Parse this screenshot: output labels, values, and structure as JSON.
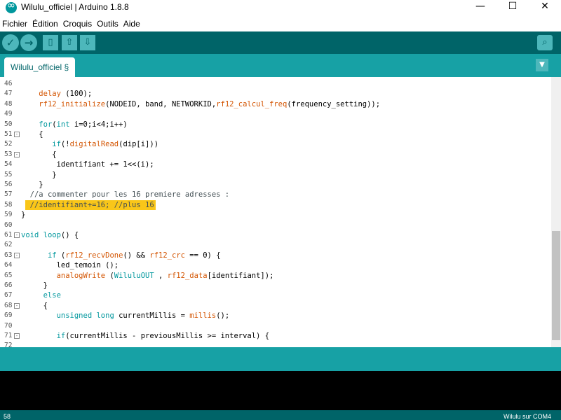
{
  "window": {
    "title": "Wilulu_officiel | Arduino 1.8.8",
    "controls": {
      "minimize": "—",
      "maximize": "☐",
      "close": "✕"
    }
  },
  "menu": [
    "Fichier",
    "Édition",
    "Croquis",
    "Outils",
    "Aide"
  ],
  "toolbar": {
    "buttons": [
      {
        "name": "verify",
        "icon": "check-icon",
        "glyph": "✓"
      },
      {
        "name": "upload",
        "icon": "arrow-right-icon",
        "glyph": "→"
      },
      {
        "name": "new",
        "icon": "new-file-icon",
        "glyph": "▯"
      },
      {
        "name": "open",
        "icon": "open-arrow-up-icon",
        "glyph": "⇧"
      },
      {
        "name": "save",
        "icon": "save-arrow-down-icon",
        "glyph": "⇩"
      }
    ],
    "serial_monitor": {
      "icon": "magnifier-icon",
      "glyph": "⌕"
    }
  },
  "tabs": [
    {
      "label": "Wilulu_officiel §"
    }
  ],
  "tab_menu_glyph": "▼",
  "editor": {
    "lines": [
      {
        "n": "46",
        "fold": "",
        "html": ""
      },
      {
        "n": "47",
        "fold": "",
        "html": "    <span class=\"f\">delay</span> (100);"
      },
      {
        "n": "48",
        "fold": "",
        "html": "    <span class=\"f\">rf12_initialize</span>(NODEID, band, NETWORKID,<span class=\"f\">rf12_calcul_freq</span>(frequency_setting));"
      },
      {
        "n": "49",
        "fold": "",
        "html": ""
      },
      {
        "n": "50",
        "fold": "",
        "html": "    <span class=\"k\">for</span>(<span class=\"k\">int</span> i=0;i&lt;4;i++)"
      },
      {
        "n": "51",
        "fold": "⊟",
        "html": "    {"
      },
      {
        "n": "52",
        "fold": "",
        "html": "       <span class=\"k\">if</span>(!<span class=\"f\">digitalRead</span>(dip[i]))"
      },
      {
        "n": "53",
        "fold": "⊟",
        "html": "       {"
      },
      {
        "n": "54",
        "fold": "",
        "html": "        identifiant += 1&lt;&lt;(i);"
      },
      {
        "n": "55",
        "fold": "",
        "html": "       }"
      },
      {
        "n": "56",
        "fold": "",
        "html": "    }"
      },
      {
        "n": "57",
        "fold": "",
        "html": "  <span class=\"c\">//a commenter pour les 16 premiere adresses :</span>"
      },
      {
        "n": "58",
        "fold": "",
        "html": "  <span class=\"c\">//identifiant+=16; //plus 16</span>",
        "highlight": true
      },
      {
        "n": "59",
        "fold": "",
        "html": "}"
      },
      {
        "n": "60",
        "fold": "",
        "html": ""
      },
      {
        "n": "61",
        "fold": "⊟",
        "html": "<span class=\"k\">void</span> <span class=\"k\">loop</span>() {"
      },
      {
        "n": "62",
        "fold": "",
        "html": ""
      },
      {
        "n": "63",
        "fold": "⊟",
        "html": "      <span class=\"k\">if</span> (<span class=\"f\">rf12_recvDone</span>() &amp;&amp; <span class=\"f\">rf12_crc</span> == 0) {"
      },
      {
        "n": "64",
        "fold": "",
        "html": "        led_temoin ();"
      },
      {
        "n": "65",
        "fold": "",
        "html": "        <span class=\"f\">analogWrite</span> (<span class=\"k\">WiluluOUT</span> , <span class=\"f\">rf12_data</span>[identifiant]);"
      },
      {
        "n": "66",
        "fold": "",
        "html": "     }"
      },
      {
        "n": "67",
        "fold": "",
        "html": "     <span class=\"k\">else</span>"
      },
      {
        "n": "68",
        "fold": "⊟",
        "html": "     {"
      },
      {
        "n": "69",
        "fold": "",
        "html": "        <span class=\"k\">unsigned</span> <span class=\"k\">long</span> currentMillis = <span class=\"f\">millis</span>();"
      },
      {
        "n": "70",
        "fold": "",
        "html": ""
      },
      {
        "n": "71",
        "fold": "⊟",
        "html": "        <span class=\"k\">if</span>(currentMillis - previousMillis &gt;= interval) {"
      },
      {
        "n": "72",
        "fold": "",
        "html": ""
      }
    ]
  },
  "status": {
    "line_number": "58",
    "board": "Wilulu sur COM4"
  }
}
